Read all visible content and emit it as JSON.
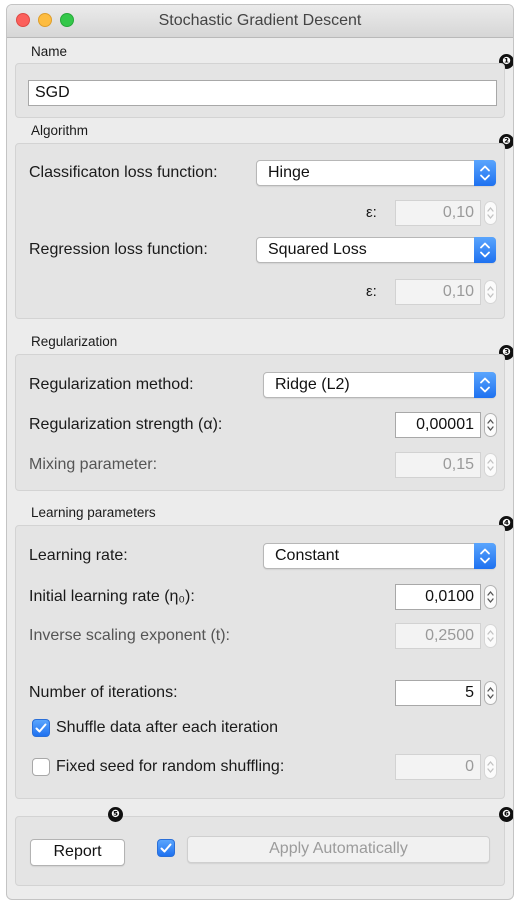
{
  "window": {
    "title": "Stochastic Gradient Descent"
  },
  "badges": [
    "❶",
    "❷",
    "❸",
    "❹",
    "❺",
    "❻"
  ],
  "name_group": {
    "title": "Name",
    "value": "SGD"
  },
  "algorithm": {
    "title": "Algorithm",
    "classification_label": "Classificaton loss function:",
    "classification_value": "Hinge",
    "epsilon_label_1": "ε:",
    "epsilon_value_1": "0,10",
    "regression_label": "Regression loss function:",
    "regression_value": "Squared Loss",
    "epsilon_label_2": "ε:",
    "epsilon_value_2": "0,10"
  },
  "regularization": {
    "title": "Regularization",
    "method_label": "Regularization method:",
    "method_value": "Ridge (L2)",
    "strength_label": "Regularization strength (α):",
    "strength_value": "0,00001",
    "mixing_label": "Mixing parameter:",
    "mixing_value": "0,15"
  },
  "learning": {
    "title": "Learning parameters",
    "rate_label": "Learning rate:",
    "rate_value": "Constant",
    "initial_label": "Initial learning rate (η₀):",
    "initial_value": "0,0100",
    "inverse_label": "Inverse scaling exponent (t):",
    "inverse_value": "0,2500",
    "iterations_label": "Number of iterations:",
    "iterations_value": "5",
    "shuffle_label": "Shuffle data after each iteration",
    "shuffle_checked": true,
    "seed_label": "Fixed seed for random shuffling:",
    "seed_checked": false,
    "seed_value": "0"
  },
  "footer": {
    "report_label": "Report",
    "apply_label": "Apply Automatically",
    "auto_checked": true
  },
  "colors": {
    "accent": "#1e71f0",
    "window_bg": "#ececec",
    "group_bg": "#e4e4e4"
  }
}
